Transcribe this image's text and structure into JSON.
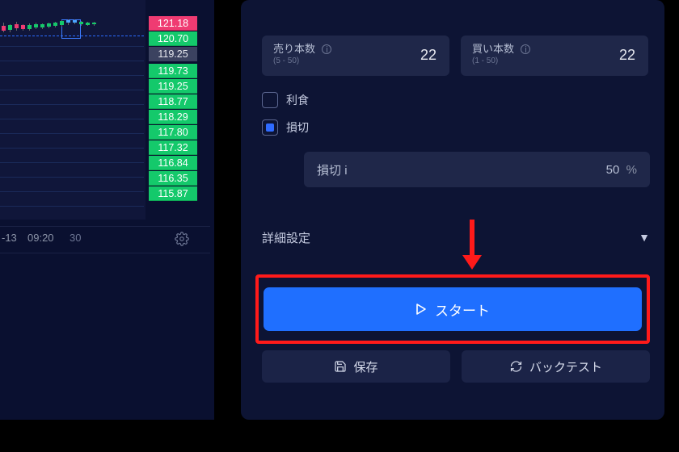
{
  "chart": {
    "scale": [
      {
        "v": "121.18",
        "c": "pink"
      },
      {
        "v": "120.70",
        "c": "green"
      },
      {
        "v": "119.25",
        "c": "gray"
      },
      {
        "v": "119.73",
        "c": "green"
      },
      {
        "v": "119.25",
        "c": "green"
      },
      {
        "v": "118.77",
        "c": "green"
      },
      {
        "v": "118.29",
        "c": "green"
      },
      {
        "v": "117.80",
        "c": "green"
      },
      {
        "v": "117.32",
        "c": "green"
      },
      {
        "v": "116.84",
        "c": "green"
      },
      {
        "v": "116.35",
        "c": "green"
      },
      {
        "v": "115.87",
        "c": "green"
      }
    ],
    "time": {
      "t1": "-13",
      "t2": "09:20",
      "t3": "30"
    }
  },
  "sell": {
    "label": "売り本数",
    "range": "(5 - 50)",
    "value": "22"
  },
  "buy": {
    "label": "買い本数",
    "range": "(1 - 50)",
    "value": "22"
  },
  "take_profit_label": "利食",
  "stop_loss_label": "損切",
  "loss_field": {
    "label": "損切",
    "value": "50",
    "unit": "%"
  },
  "advanced_label": "詳細設定",
  "start_label": "スタート",
  "save_label": "保存",
  "backtest_label": "バックテスト"
}
